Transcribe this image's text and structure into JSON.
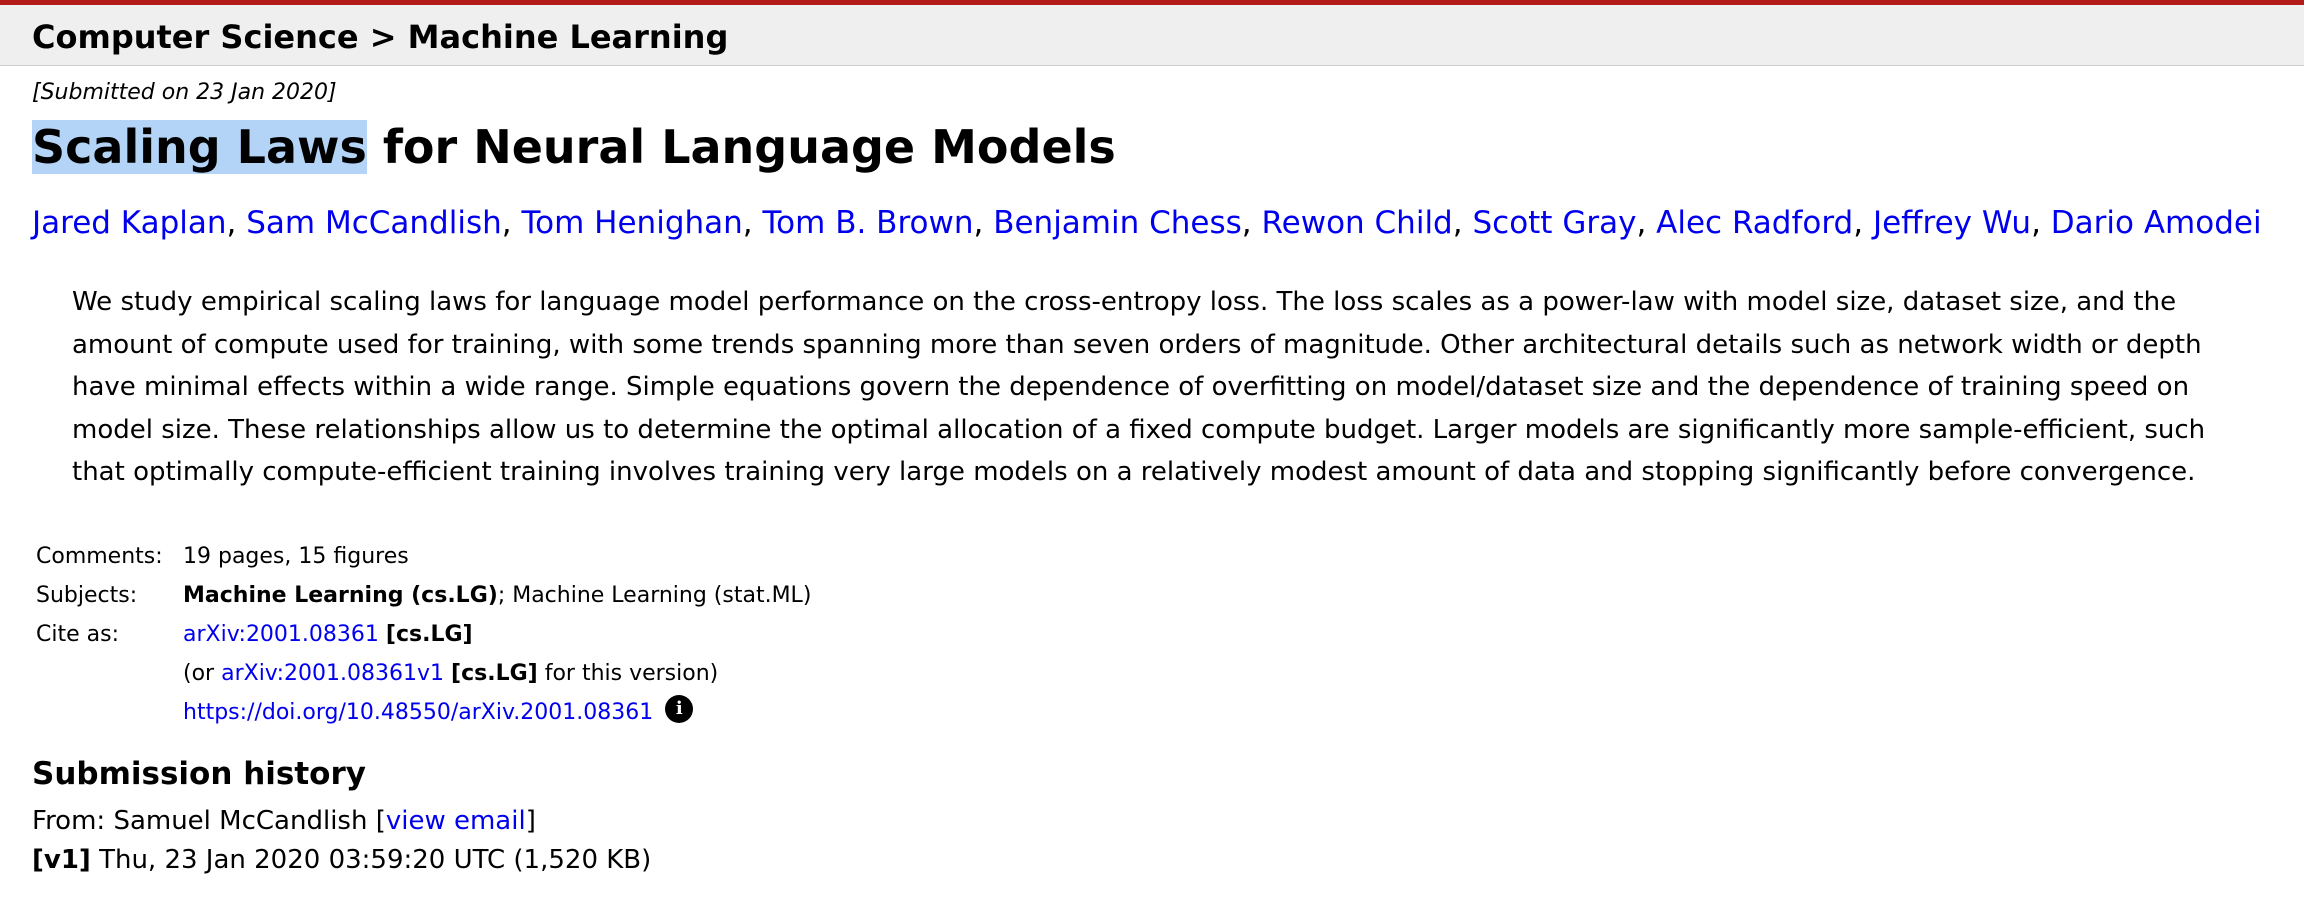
{
  "breadcrumb": "Computer Science > Machine Learning",
  "submitted": "[Submitted on 23 Jan 2020]",
  "title": {
    "highlighted": "Scaling Laws",
    "rest": " for Neural Language Models"
  },
  "authors": [
    "Jared Kaplan",
    "Sam McCandlish",
    "Tom Henighan",
    "Tom B. Brown",
    "Benjamin Chess",
    "Rewon Child",
    "Scott Gray",
    "Alec Radford",
    "Jeffrey Wu",
    "Dario Amodei"
  ],
  "abstract": [
    "We study empirical scaling laws for language model performance on the cross-entropy loss. The loss scales as a power-law with model size, dataset size, and the",
    "amount of compute used for training, with some trends spanning more than seven orders of magnitude. Other architectural details such as network width or depth",
    "have minimal effects within a wide range. Simple equations govern the dependence of overfitting on model/dataset size and the dependence of training speed on",
    "model size. These relationships allow us to determine the optimal allocation of a fixed compute budget. Larger models are significantly more sample-efficient, such",
    "that optimally compute-efficient training involves training very large models on a relatively modest amount of data and stopping significantly before convergence."
  ],
  "meta": {
    "comments_label": "Comments:",
    "comments_value": "19 pages, 15 figures",
    "subjects_label": "Subjects:",
    "subjects_primary": "Machine Learning (cs.LG)",
    "subjects_rest": "; Machine Learning (stat.ML)",
    "cite_label": "Cite as:",
    "cite_id": "arXiv:2001.08361",
    "cite_cat": "[cs.LG]",
    "version_prefix": "(or ",
    "version_id": "arXiv:2001.08361v1",
    "version_cat": "[cs.LG]",
    "version_suffix": " for this version)",
    "doi": "https://doi.org/10.48550/arXiv.2001.08361",
    "info_icon": "i"
  },
  "history": {
    "heading": "Submission history",
    "from_prefix": "From: Samuel McCandlish [",
    "view_email": "view email",
    "from_suffix": "]",
    "v1_label": "[v1]",
    "v1_text": " Thu, 23 Jan 2020 03:59:20 UTC (1,520 KB)"
  },
  "colors": {
    "link": "#0000ee",
    "header_accent": "#b31b1b",
    "header_bg": "#efefef",
    "highlight": "#b4d4f7"
  }
}
